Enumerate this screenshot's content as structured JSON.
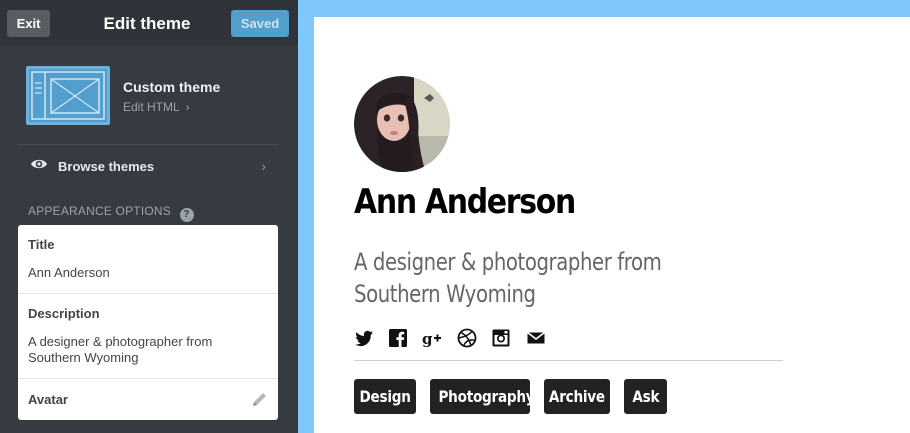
{
  "topbar": {
    "exit_label": "Exit",
    "title": "Edit theme",
    "saved_label": "Saved"
  },
  "theme": {
    "name": "Custom theme",
    "edit_html_label": "Edit HTML",
    "edit_html_chevron": "›"
  },
  "browse": {
    "label": "Browse themes",
    "chevron": "›"
  },
  "appearance": {
    "label": "APPEARANCE OPTIONS",
    "help_icon": "?"
  },
  "options": {
    "title": {
      "label": "Title",
      "value": "Ann Anderson"
    },
    "description": {
      "label": "Description",
      "value": "A designer & photographer from Southern Wyoming"
    },
    "avatar": {
      "label": "Avatar",
      "icon": "pencil-icon"
    }
  },
  "preview": {
    "blog_title": "Ann Anderson",
    "blog_description": "A designer & photographer from Southern Wyoming",
    "social_icons": [
      "twitter-icon",
      "facebook-icon",
      "google-plus-icon",
      "dribbble-icon",
      "instagram-icon",
      "mail-icon"
    ],
    "nav": [
      "Design",
      "Photography",
      "Archive",
      "Ask"
    ]
  },
  "colors": {
    "sidebar_bg": "#363b42",
    "topbar_bg": "#2f343a",
    "saved_button": "#529ecc",
    "preview_frame": "#7fc8fb",
    "nav_button_bg": "#222222"
  }
}
